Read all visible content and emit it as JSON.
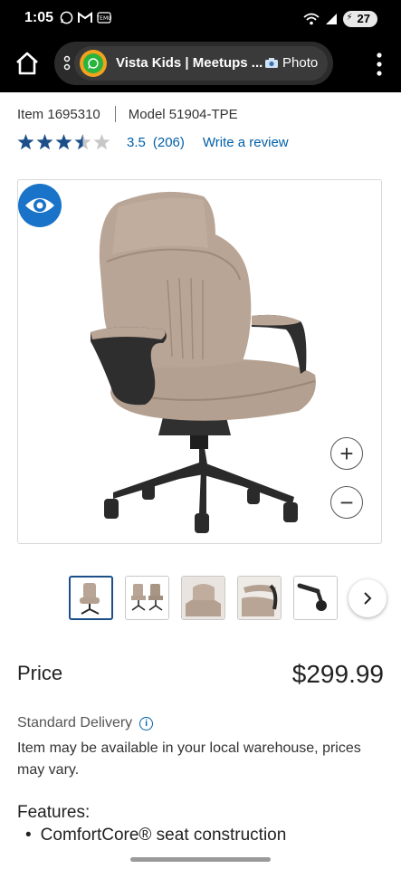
{
  "status_bar": {
    "time": "1:05",
    "battery": "27",
    "icons": [
      "whatsapp-icon",
      "gmail-icon",
      "temu-icon",
      "wifi-icon",
      "signal-icon",
      "battery-icon"
    ]
  },
  "browser": {
    "tab_title": "Vista Kids | Meetups ...",
    "photo_label": "Photo"
  },
  "product": {
    "item_label": "Item",
    "item_number": "1695310",
    "model_label": "Model",
    "model_number": "51904-TPE",
    "rating": "3.5",
    "rating_value": 3.5,
    "review_count": "(206)",
    "write_review": "Write a review",
    "zoom_in": "+",
    "zoom_out": "−",
    "price_label": "Price",
    "price": "$299.99",
    "delivery": "Standard Delivery",
    "availability": "Item may be available in your local warehouse, prices may vary.",
    "features_title": "Features:",
    "features": [
      "ComfortCore® seat construction"
    ]
  },
  "colors": {
    "accent_blue": "#0060a9",
    "star_color": "#1c4f8a",
    "eye_button": "#1873c9",
    "chair_fabric": "#b9a596"
  }
}
